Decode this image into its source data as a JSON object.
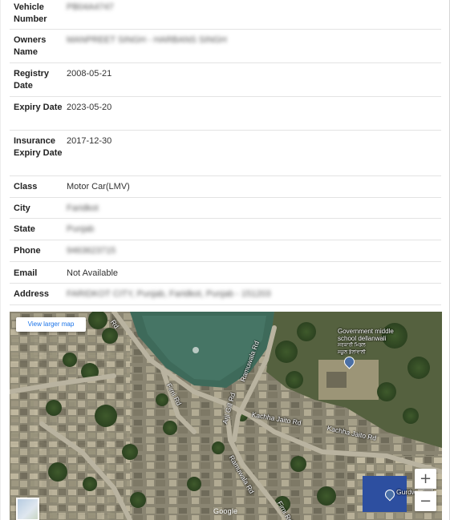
{
  "vehicle_details": {
    "rows": [
      {
        "label": "Vehicle Number",
        "value": "PB04A4747"
      },
      {
        "label": "Owners Name",
        "value": "MANPREET SINGH - HARBANS SINGH"
      },
      {
        "label": "Registry Date",
        "value": "2008-05-21"
      },
      {
        "label": "Expiry Date",
        "value": "2023-05-20"
      },
      {
        "label": "Insurance Expiry Date",
        "value": "2017-12-30"
      },
      {
        "label": "Class",
        "value": "Motor Car(LMV)"
      },
      {
        "label": "City",
        "value": "Faridkot"
      },
      {
        "label": "State",
        "value": "Punjab"
      },
      {
        "label": "Phone",
        "value": "9463623715"
      },
      {
        "label": "Email",
        "value": "Not Available"
      },
      {
        "label": "Address",
        "value": "FARIDKOT CITY, Punjab, Faridkot, Punjab - 151203"
      }
    ],
    "redacted_fields": [
      "Vehicle Number",
      "Owners Name",
      "City",
      "State",
      "Phone",
      "Address"
    ]
  },
  "map": {
    "larger_map_link": "View larger map",
    "zoom_in": "+",
    "zoom_out": "−",
    "google": "Google",
    "poi": {
      "line1": "Government middle",
      "line2": "school dellanwali",
      "line3": "ਸਰਕਾਰੀ ਮਿਡਲ",
      "line4": "ਸਕੂਲ ਡੱਲਾਂਵਾਲੀ"
    },
    "gurdwara_label": "Gurdw",
    "roads": {
      "road_a": "Rd",
      "firni_1": "Firni Rd",
      "ramuwala_1": "Ramuwala Rd",
      "arji_gill": "Arji Gill Rd",
      "kachha_1": "Kachha Jaito Rd",
      "kachha_2": "Kachha Jaito Rd",
      "ramuwala_2": "Ramuwala Rd",
      "firni_2": "Firni Rd"
    }
  }
}
